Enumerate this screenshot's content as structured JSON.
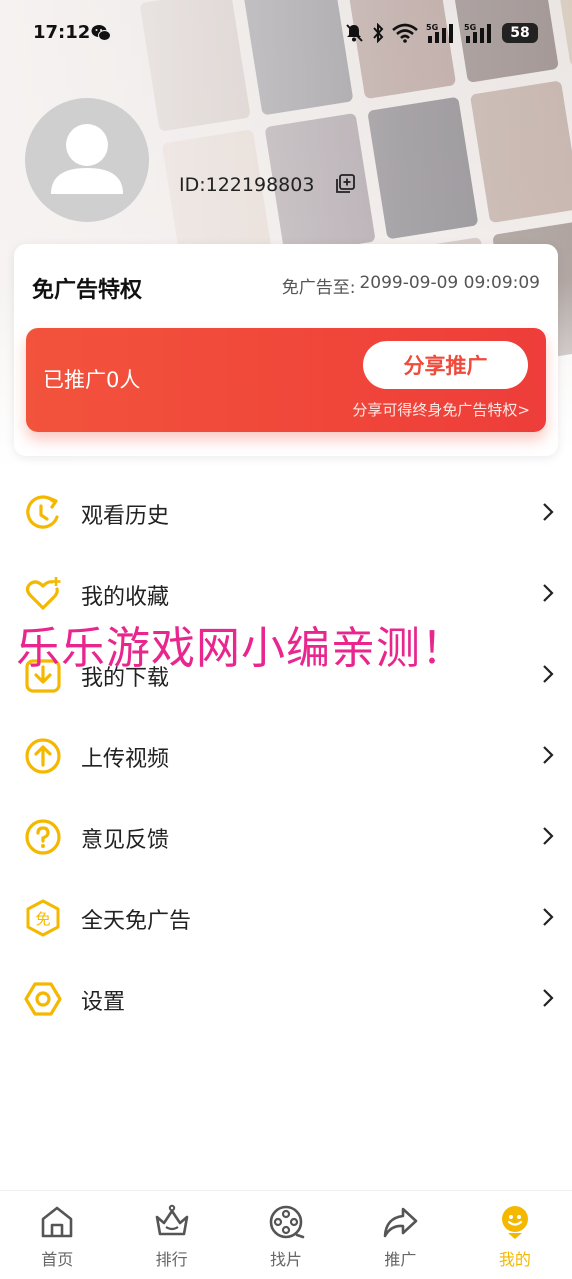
{
  "status_bar": {
    "time": "17:12",
    "battery": "58"
  },
  "profile": {
    "user_id": "ID:122198803"
  },
  "vip": {
    "title": "免广告特权",
    "expiry_label": "免广告至:",
    "expiry_value": "2099-09-09 09:09:09",
    "promo_count": "已推广0人",
    "share_button": "分享推广",
    "promo_hint": "分享可得终身免广告特权>"
  },
  "menu": {
    "items": [
      {
        "label": "观看历史",
        "icon": "history-icon"
      },
      {
        "label": "我的收藏",
        "icon": "favorite-heart-icon"
      },
      {
        "label": "我的下载",
        "icon": "download-icon"
      },
      {
        "label": "上传视频",
        "icon": "upload-icon"
      },
      {
        "label": "意见反馈",
        "icon": "feedback-question-icon"
      },
      {
        "label": "全天免广告",
        "icon": "ad-free-icon"
      },
      {
        "label": "设置",
        "icon": "settings-hex-icon"
      }
    ]
  },
  "watermark": "乐乐游戏网小编亲测！",
  "tabs": [
    {
      "label": "首页",
      "icon": "home-icon",
      "active": false
    },
    {
      "label": "排行",
      "icon": "crown-icon",
      "active": false
    },
    {
      "label": "找片",
      "icon": "film-reel-icon",
      "active": false
    },
    {
      "label": "推广",
      "icon": "share-arrow-icon",
      "active": false
    },
    {
      "label": "我的",
      "icon": "profile-icon",
      "active": true
    }
  ],
  "colors": {
    "accent_yellow": "#f5b800",
    "promo_red": "#f0463a",
    "watermark_pink": "#e8268e"
  }
}
